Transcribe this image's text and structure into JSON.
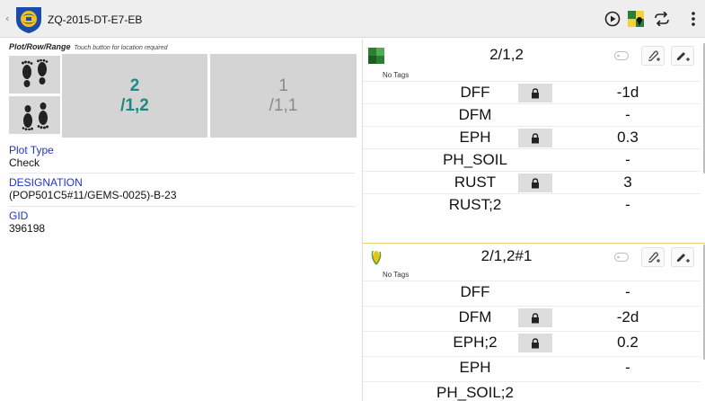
{
  "app": {
    "title": "ZQ-2015-DT-E7-EB",
    "back": "‹",
    "logo_icon": "cimmyt-logo-icon"
  },
  "toolbar": {
    "actions": [
      "play-circle-icon",
      "map-pin-icon",
      "repeat-icon",
      "more-vert-icon"
    ]
  },
  "plot_row_range": {
    "label": "Plot/Row/Range",
    "hint": "Touch button for location required",
    "current": {
      "num": "2",
      "loc": "/1,2"
    },
    "next": {
      "num": "1",
      "loc": "/1,1"
    },
    "colors": {
      "current": "#1a8a82",
      "next": "#8a8a8a"
    }
  },
  "plot_info": {
    "plot_type_label": "Plot Type",
    "plot_type_value": "Check",
    "designation_label": "DESIGNATION",
    "designation_value": "(POP501C5#11/GEMS-0025)-B-23",
    "gid_label": "GID",
    "gid_value": "396198"
  },
  "plots": [
    {
      "name": "2/1,2",
      "thumb_icon": "plot-grid-icon",
      "tags_label": "No Tags",
      "traits": [
        {
          "name": "DFF",
          "locked": true,
          "value": "-1d"
        },
        {
          "name": "DFM",
          "locked": false,
          "value": "-"
        },
        {
          "name": "EPH",
          "locked": true,
          "value": "0.3"
        },
        {
          "name": "PH_SOIL",
          "locked": false,
          "value": "-"
        },
        {
          "name": "RUST",
          "locked": true,
          "value": "3"
        },
        {
          "name": "RUST;2",
          "locked": false,
          "value": "-"
        }
      ]
    },
    {
      "name": "2/1,2#1",
      "thumb_icon": "corn-plant-icon",
      "tags_label": "No Tags",
      "traits": [
        {
          "name": "DFF",
          "locked": false,
          "value": "-"
        },
        {
          "name": "DFM",
          "locked": true,
          "value": "-2d"
        },
        {
          "name": "EPH;2",
          "locked": true,
          "value": "0.2"
        },
        {
          "name": "EPH",
          "locked": false,
          "value": "-"
        },
        {
          "name": "PH_SOIL;2",
          "locked": false,
          "value": ""
        }
      ]
    }
  ]
}
